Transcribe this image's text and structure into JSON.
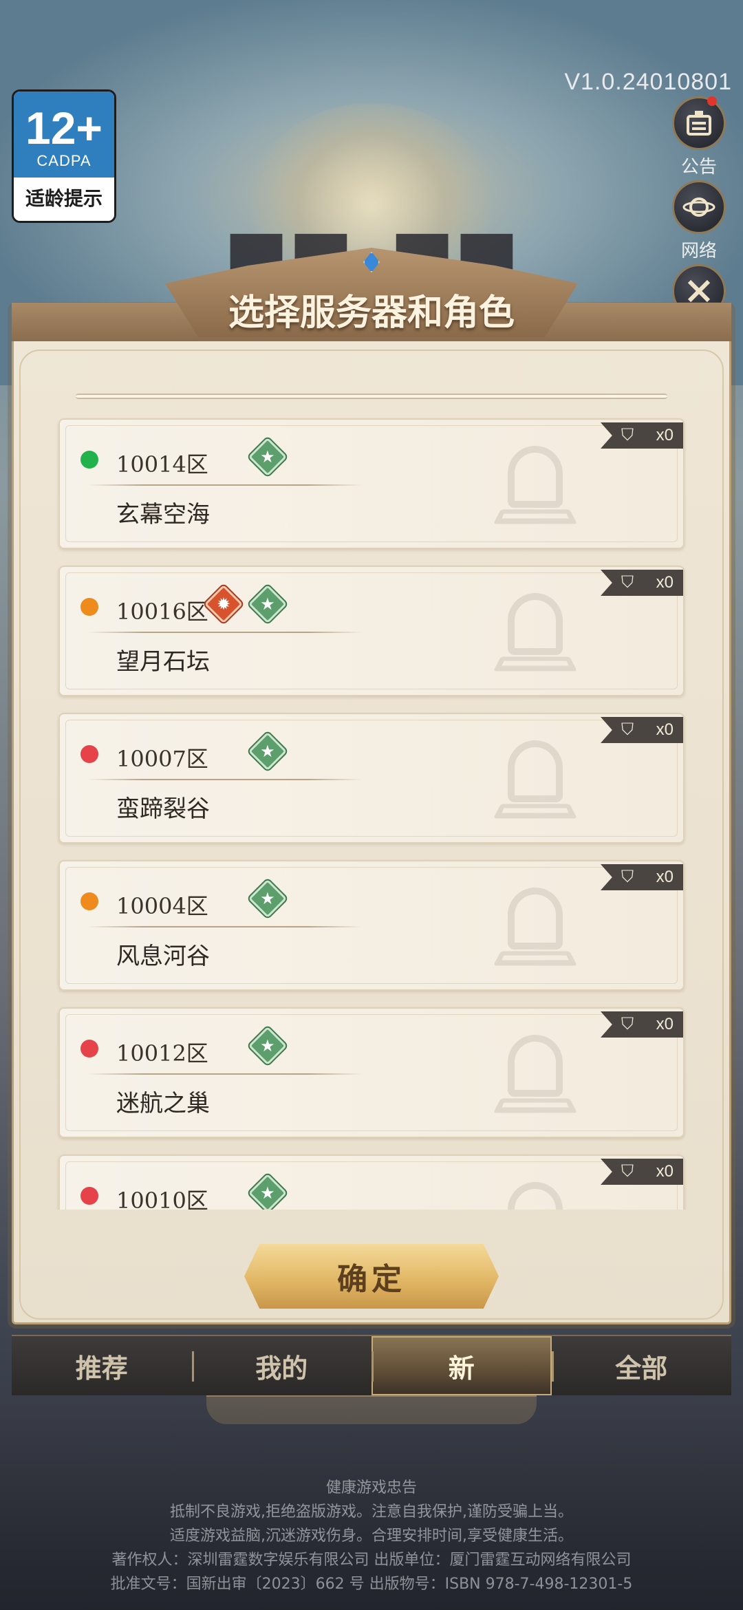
{
  "age_rating": {
    "number": "12+",
    "org": "CADPA",
    "tip": "适龄提示"
  },
  "version": "V1.0.24010801",
  "side_buttons": [
    {
      "label": "公告",
      "icon": "announcement-icon",
      "has_dot": true
    },
    {
      "label": "网络",
      "icon": "network-icon"
    },
    {
      "label": "",
      "icon": "tools-icon"
    }
  ],
  "panel": {
    "title": "选择服务器和角色"
  },
  "servers": [
    {
      "zone": "10014区",
      "name": "玄幕空海",
      "status": "green",
      "status_color": "#22b24c",
      "badges": [
        "new"
      ],
      "role_count": "x0"
    },
    {
      "zone": "10016区",
      "name": "望月石坛",
      "status": "orange",
      "status_color": "#ef8a1c",
      "badges": [
        "hot",
        "new"
      ],
      "role_count": "x0"
    },
    {
      "zone": "10007区",
      "name": "蛮蹄裂谷",
      "status": "red",
      "status_color": "#e5424a",
      "badges": [
        "new"
      ],
      "role_count": "x0"
    },
    {
      "zone": "10004区",
      "name": "风息河谷",
      "status": "orange",
      "status_color": "#ef8a1c",
      "badges": [
        "new"
      ],
      "role_count": "x0"
    },
    {
      "zone": "10012区",
      "name": "迷航之巢",
      "status": "red",
      "status_color": "#e5424a",
      "badges": [
        "new"
      ],
      "role_count": "x0"
    },
    {
      "zone": "10010区",
      "name": "",
      "status": "red",
      "status_color": "#e5424a",
      "badges": [
        "new"
      ],
      "role_count": "x0"
    }
  ],
  "confirm_label": "确定",
  "tabs": [
    {
      "label": "推荐",
      "active": false
    },
    {
      "label": "我的",
      "active": false
    },
    {
      "label": "新",
      "active": true
    },
    {
      "label": "全部",
      "active": false
    }
  ],
  "health_notice": [
    "健康游戏忠告",
    "抵制不良游戏,拒绝盗版游戏。注意自我保护,谨防受骗上当。",
    "适度游戏益脑,沉迷游戏伤身。合理安排时间,享受健康生活。",
    "著作权人：深圳雷霆数字娱乐有限公司 出版单位：厦门雷霆互动网络有限公司",
    "批准文号：国新出审〔2023〕662 号 出版物号：ISBN 978-7-498-12301-5"
  ]
}
